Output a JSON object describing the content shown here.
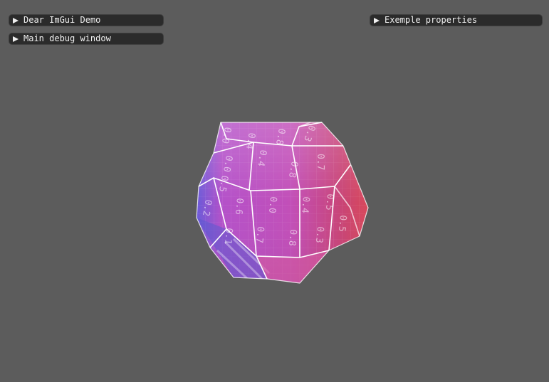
{
  "windows": [
    {
      "id": "demo",
      "title": "Dear ImGui Demo",
      "collapsed": true
    },
    {
      "id": "debug",
      "title": "Main debug window",
      "collapsed": true
    },
    {
      "id": "props",
      "title": "Exemple properties",
      "collapsed": true
    }
  ],
  "icons": {
    "collapse_arrow": "triangle-right-icon"
  },
  "colors": {
    "background": "#5c5c5c",
    "header_bg": "#2b2b2b",
    "header_text": "#f0f0f0",
    "mesh_left": "#6a5ad8",
    "mesh_center": "#c24fb8",
    "mesh_right": "#d8485a",
    "mesh_edges": "#ffffff"
  },
  "scene": {
    "object": "dodecahedron-mesh",
    "uv_labels": [
      "0.0",
      "0.4",
      "0.8",
      "0.3",
      "0.0",
      "0.4",
      "0.8",
      "0.7",
      "0.5",
      "0.2",
      "0.6",
      "0.0",
      "0.4",
      "0.5",
      "0.1",
      "0.7",
      "0.8",
      "0.3",
      "0.5"
    ]
  }
}
